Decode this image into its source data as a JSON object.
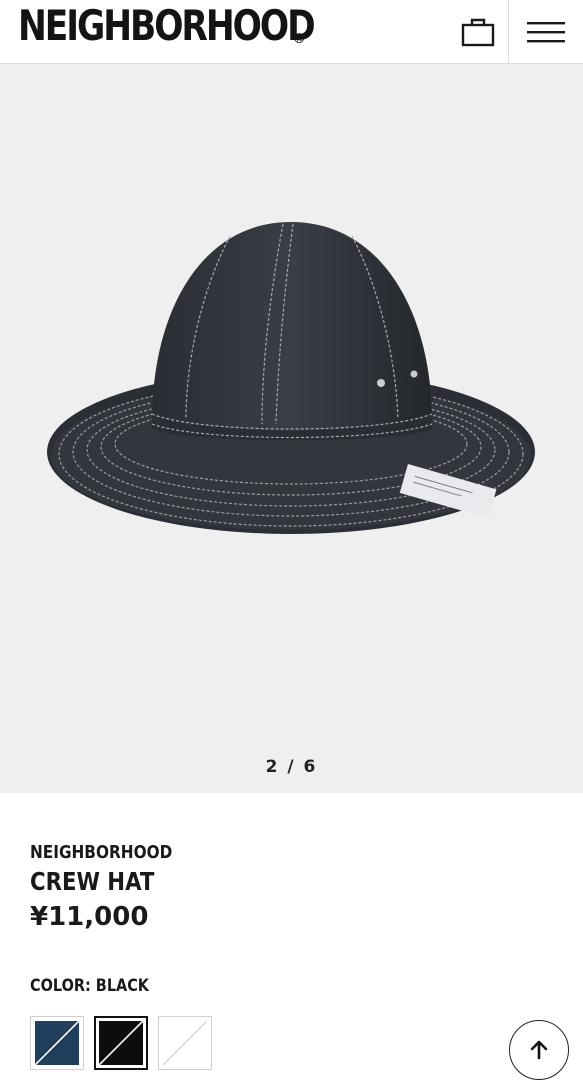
{
  "header": {
    "logo_text": "NEIGHBORHOOD",
    "logo_reg": "®",
    "bag_icon": "shopping-bag-icon",
    "menu_icon": "hamburger-menu-icon"
  },
  "gallery": {
    "image_alt": "denim hat",
    "counter": "2 / 6",
    "background": "#efefef"
  },
  "product": {
    "brand": "NEIGHBORHOOD",
    "name": "CREW HAT",
    "price": "¥11,000",
    "color_label": "COLOR: BLACK"
  },
  "swatches": [
    {
      "name": "navy",
      "color": "#1f3f5c",
      "selected": false
    },
    {
      "name": "black",
      "color": "#0d0d0d",
      "selected": true
    },
    {
      "name": "white",
      "color": "#ffffff",
      "selected": false
    }
  ],
  "back_to_top_icon": "arrow-up-icon"
}
